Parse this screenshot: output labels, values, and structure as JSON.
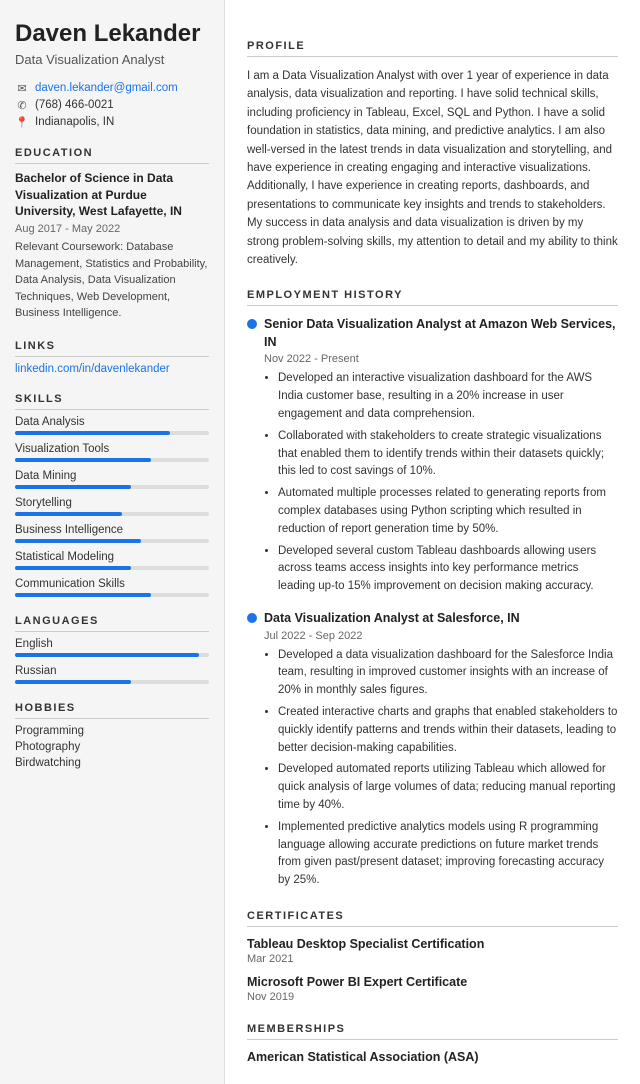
{
  "sidebar": {
    "name": "Daven Lekander",
    "title": "Data Visualization Analyst",
    "contact": {
      "email": "daven.lekander@gmail.com",
      "phone": "(768) 466-0021",
      "location": "Indianapolis, IN"
    },
    "sections": {
      "education_label": "EDUCATION",
      "education": {
        "degree": "Bachelor of Science in Data Visualization at Purdue University, West Lafayette, IN",
        "date": "Aug 2017 - May 2022",
        "coursework_label": "Relevant Coursework:",
        "coursework": "Database Management, Statistics and Probability, Data Analysis, Data Visualization Techniques, Web Development, Business Intelligence."
      },
      "links_label": "LINKS",
      "links": [
        {
          "text": "linkedin.com/in/davenlekander",
          "url": "#"
        }
      ],
      "skills_label": "SKILLS",
      "skills": [
        {
          "name": "Data Analysis",
          "pct": 80
        },
        {
          "name": "Visualization Tools",
          "pct": 70
        },
        {
          "name": "Data Mining",
          "pct": 60
        },
        {
          "name": "Storytelling",
          "pct": 55
        },
        {
          "name": "Business Intelligence",
          "pct": 65
        },
        {
          "name": "Statistical Modeling",
          "pct": 60
        },
        {
          "name": "Communication Skills",
          "pct": 70
        }
      ],
      "languages_label": "LANGUAGES",
      "languages": [
        {
          "name": "English",
          "pct": 95
        },
        {
          "name": "Russian",
          "pct": 60
        }
      ],
      "hobbies_label": "HOBBIES",
      "hobbies": [
        "Programming",
        "Photography",
        "Birdwatching"
      ]
    }
  },
  "main": {
    "profile_label": "PROFILE",
    "profile_text": "I am a Data Visualization Analyst with over 1 year of experience in data analysis, data visualization and reporting. I have solid technical skills, including proficiency in Tableau, Excel, SQL and Python. I have a solid foundation in statistics, data mining, and predictive analytics. I am also well-versed in the latest trends in data visualization and storytelling, and have experience in creating engaging and interactive visualizations. Additionally, I have experience in creating reports, dashboards, and presentations to communicate key insights and trends to stakeholders. My success in data analysis and data visualization is driven by my strong problem-solving skills, my attention to detail and my ability to think creatively.",
    "employment_label": "EMPLOYMENT HISTORY",
    "jobs": [
      {
        "title": "Senior Data Visualization Analyst at Amazon Web Services, IN",
        "date": "Nov 2022 - Present",
        "bullets": [
          "Developed an interactive visualization dashboard for the AWS India customer base, resulting in a 20% increase in user engagement and data comprehension.",
          "Collaborated with stakeholders to create strategic visualizations that enabled them to identify trends within their datasets quickly; this led to cost savings of 10%.",
          "Automated multiple processes related to generating reports from complex databases using Python scripting which resulted in reduction of report generation time by 50%.",
          "Developed several custom Tableau dashboards allowing users across teams access insights into key performance metrics leading up-to 15% improvement on decision making accuracy."
        ]
      },
      {
        "title": "Data Visualization Analyst at Salesforce, IN",
        "date": "Jul 2022 - Sep 2022",
        "bullets": [
          "Developed a data visualization dashboard for the Salesforce India team, resulting in improved customer insights with an increase of 20% in monthly sales figures.",
          "Created interactive charts and graphs that enabled stakeholders to quickly identify patterns and trends within their datasets, leading to better decision-making capabilities.",
          "Developed automated reports utilizing Tableau which allowed for quick analysis of large volumes of data; reducing manual reporting time by 40%.",
          "Implemented predictive analytics models using R programming language allowing accurate predictions on future market trends from given past/present dataset; improving forecasting accuracy by 25%."
        ]
      }
    ],
    "certificates_label": "CERTIFICATES",
    "certificates": [
      {
        "name": "Tableau Desktop Specialist Certification",
        "date": "Mar 2021"
      },
      {
        "name": "Microsoft Power BI Expert Certificate",
        "date": "Nov 2019"
      }
    ],
    "memberships_label": "MEMBERSHIPS",
    "memberships": [
      {
        "name": "American Statistical Association (ASA)"
      }
    ]
  }
}
